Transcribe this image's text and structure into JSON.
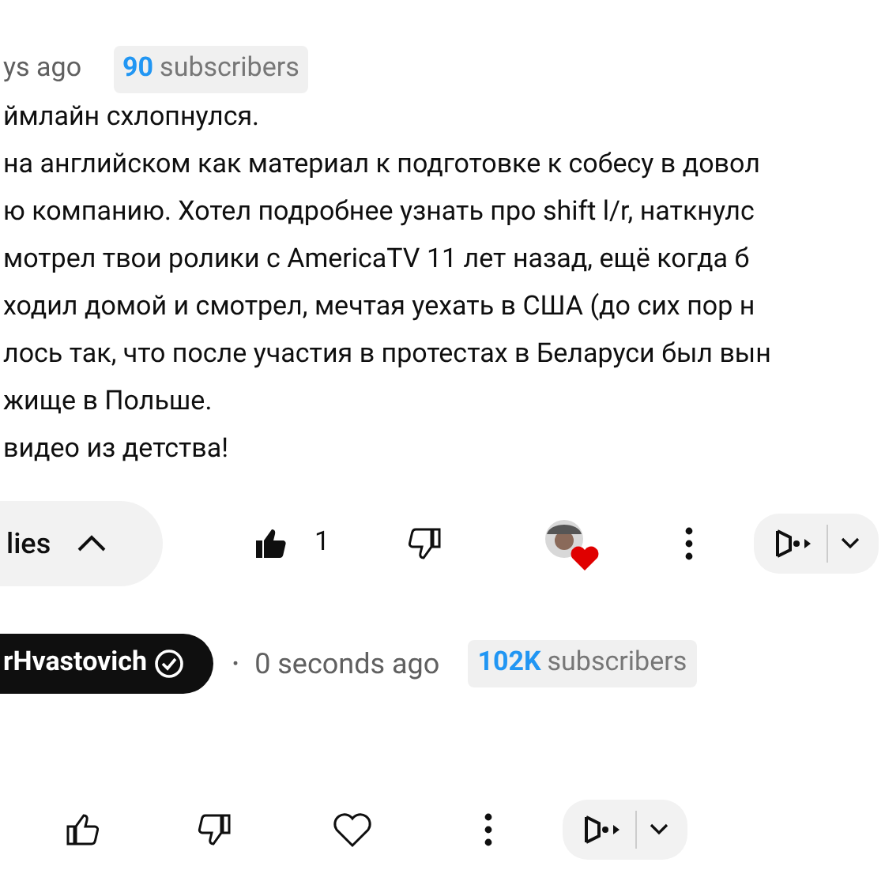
{
  "comment": {
    "time": "ys ago",
    "subscriber_badge": {
      "count": "90",
      "label": "subscribers"
    },
    "lines": [
      "ймлайн схлопнулся.",
      "на английском как материал к подготовке к собесу в довол",
      "ю компанию. Хотел подробнее узнать про shift l/r, наткнулс",
      "мотрел твои ролики с AmericaTV 11 лет назад, ещё когда б",
      "ходил домой и смотрел, мечтая уехать в США (до сих пор н",
      "лось так, что после участия в протестах в Беларуси был вын",
      "жище в Польше.",
      "видео из детства!"
    ],
    "replies_button": {
      "label": "lies",
      "expanded": true
    },
    "likes": "1",
    "liked": true,
    "creator_heart": true
  },
  "reply": {
    "author": "rHvastovich",
    "verified": true,
    "separator": "•",
    "time": "0 seconds ago",
    "subscriber_badge": {
      "count": "102K",
      "label": "subscribers"
    },
    "liked": false,
    "creator_heart": false
  }
}
